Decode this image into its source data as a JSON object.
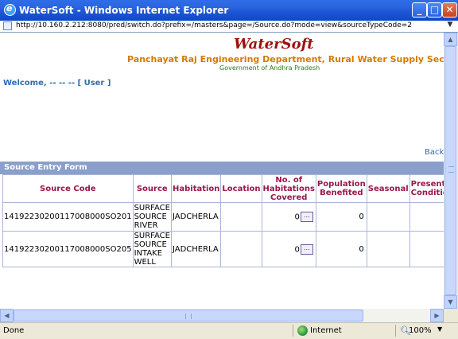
{
  "window": {
    "title": "WaterSoft - Windows Internet Explorer",
    "url": "http://10.160.2.212:8080/pred/switch.do?prefix=/masters&page=/Source.do?mode=view&sourceTypeCode=2"
  },
  "header": {
    "brand": "WaterSoft",
    "department": "Panchayat Raj Engineering Department, Rural Water Supply Sector",
    "government": "Government of Andhra Pradesh"
  },
  "welcome": {
    "prefix": "Welcome, -- -- -- ",
    "user_link": "[ User ]"
  },
  "back_link": "Back",
  "form": {
    "title": "Source Entry Form",
    "columns": [
      "Source Code",
      "Source",
      "Habitation",
      "Location",
      "No. of Habitations Covered",
      "Population Benefited",
      "Seasonal",
      "Present Condition"
    ],
    "rows": [
      {
        "source_code": "14192230200117008000SO201",
        "source": "SURFACE SOURCE RIVER",
        "habitation": "JADCHERLA",
        "location": "",
        "habitations_covered": "0",
        "pick": "...",
        "population": "0",
        "seasonal": "",
        "condition": ""
      },
      {
        "source_code": "14192230200117008000SO205",
        "source": "SURFACE SOURCE INTAKE WELL",
        "habitation": "JADCHERLA",
        "location": "",
        "habitations_covered": "0",
        "pick": "...",
        "population": "0",
        "seasonal": "",
        "condition": ""
      }
    ]
  },
  "statusbar": {
    "status": "Done",
    "zone": "Internet",
    "zoom": "100%"
  },
  "icons": {
    "browser": "ie-icon",
    "zone": "globe-icon",
    "zoom": "magnifier-icon"
  }
}
